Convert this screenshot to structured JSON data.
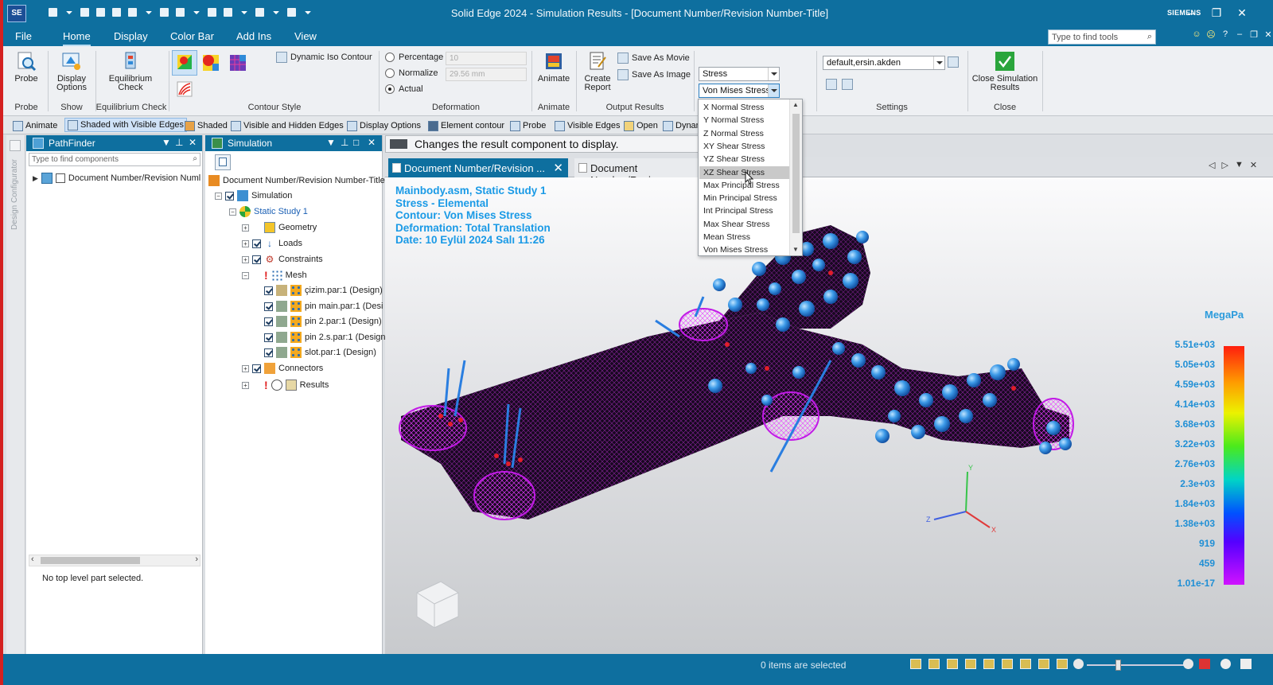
{
  "window": {
    "title": "Solid Edge 2024 - Simulation Results - [Document Number/Revision Number-Title]",
    "brand": "SIEMENS",
    "logo": "SE"
  },
  "menu": {
    "items": [
      "File",
      "Home",
      "Display",
      "Color Bar",
      "Add Ins",
      "View"
    ],
    "active": "Home",
    "find_placeholder": "Type to find tools"
  },
  "ribbon": {
    "probe": {
      "label": "Probe",
      "group": "Probe"
    },
    "display_options": {
      "label1": "Display",
      "label2": "Options"
    },
    "show_group": "Show",
    "equilibrium": {
      "label1": "Equilibrium",
      "label2": "Check",
      "group": "Equilibrium Check"
    },
    "dynamic_iso": "Dynamic Iso Contour",
    "contour_group": "Contour Style",
    "deformation": {
      "percentage": "Percentage",
      "percentage_value": "10",
      "normalize": "Normalize",
      "normalize_value": "29.56 mm",
      "actual": "Actual",
      "group": "Deformation"
    },
    "animate": {
      "label": "Animate",
      "group": "Animate"
    },
    "create_report": {
      "label1": "Create",
      "label2": "Report"
    },
    "save_movie": "Save As Movie",
    "save_image": "Save As Image",
    "output_group": "Output Results",
    "result_type": "Stress",
    "result_component": "Von Mises Stress",
    "settings_combo": "default,ersin.akden",
    "settings_group": "Settings",
    "close_sim": {
      "label1": "Close Simulation",
      "label2": "Results",
      "group": "Close"
    }
  },
  "commandbar": [
    "Animate",
    "Shaded with Visible Edges",
    "Shaded",
    "Visible and Hidden Edges",
    "Display Options",
    "Element contour",
    "Probe",
    "Visible Edges",
    "Open",
    "Dynan"
  ],
  "side_strip": "Design Configurator",
  "pathfinder": {
    "title": "PathFinder",
    "search_placeholder": "Type to find components",
    "root": "Document Number/Revision Numl",
    "status": "No top level part selected."
  },
  "simulation": {
    "title": "Simulation",
    "root": "Document Number/Revision Number-Title",
    "nodes": [
      "Simulation",
      "Static Study 1",
      "Geometry",
      "Loads",
      "Constraints",
      "Mesh",
      "çizim.par:1 (Design)",
      "pin main.par:1 (Desi",
      "pin 2.par:1 (Design)",
      "pin 2.s.par:1 (Design",
      "slot.par:1 (Design)",
      "Connectors",
      "Results"
    ]
  },
  "tooltip": "Changes the result component to display.",
  "tabs": {
    "active": "Document Number/Revision ...",
    "second": "Document Number/Revis"
  },
  "viewport": {
    "info": [
      "Mainbody.asm, Static Study 1",
      "Stress - Elemental",
      "Contour: Von Mises Stress",
      "Deformation: Total Translation",
      "Date: 10 Eylül 2024 Salı  11:26"
    ],
    "unit": "MegaPa",
    "legend": [
      "5.51e+03",
      "5.05e+03",
      "4.59e+03",
      "4.14e+03",
      "3.68e+03",
      "3.22e+03",
      "2.76e+03",
      "2.3e+03",
      "1.84e+03",
      "1.38e+03",
      "919",
      "459",
      "1.01e-17"
    ],
    "axis": {
      "x": "X",
      "y": "Y",
      "z": "Z"
    }
  },
  "dropdown": {
    "items": [
      "X Normal Stress",
      "Y Normal Stress",
      "Z Normal Stress",
      "XY Shear Stress",
      "YZ Shear Stress",
      "XZ Shear Stress",
      "Max Principal Stress",
      "Min Principal Stress",
      "Int Principal Stress",
      "Max Shear Stress",
      "Mean Stress",
      "Von Mises Stress"
    ],
    "highlighted": "XZ Shear Stress"
  },
  "status": {
    "text": "0 items are selected"
  },
  "colors": {
    "accent": "#0e6f9f",
    "info_text": "#1a9ae6",
    "mesh": "#d21ff0"
  }
}
